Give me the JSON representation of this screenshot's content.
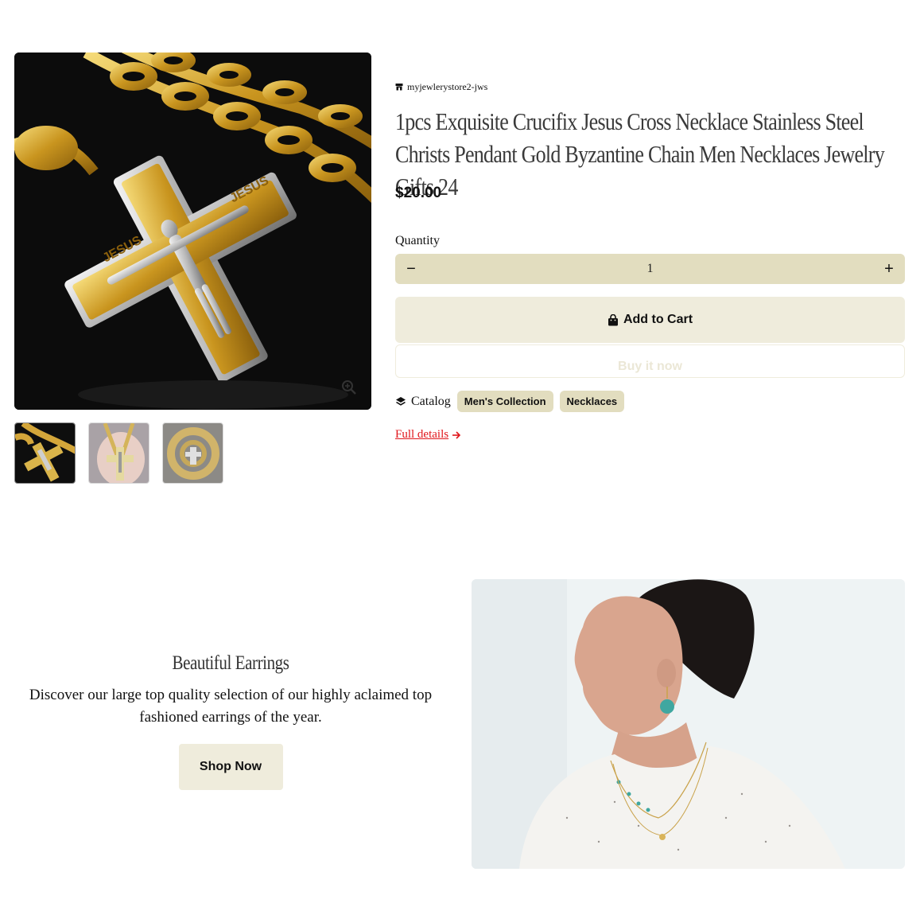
{
  "product": {
    "vendor": "myjewlerystore2-jws",
    "title": "1pcs Exquisite Crucifix Jesus Cross Necklace Stainless Steel Christs Pendant Gold Byzantine Chain Men Necklaces Jewelry Gifts 24",
    "price": "$20.00",
    "quantity_label": "Quantity",
    "quantity_value": "1",
    "decrease_symbol": "−",
    "increase_symbol": "+",
    "add_to_cart_label": "Add to Cart",
    "buy_now_label": "Buy it now",
    "catalog_label": "Catalog",
    "tags": [
      "Men's Collection",
      "Necklaces"
    ],
    "full_details_label": "Full details",
    "cross_engraving": "JESUS"
  },
  "banner": {
    "heading": "Beautiful Earrings",
    "description": "Discover our large top quality selection of our highly aclaimed top fashioned earrings of the year.",
    "button_label": "Shop Now"
  },
  "icons": {
    "vendor": "store-icon",
    "zoom": "zoom-in-icon",
    "cart": "shopping-bag-icon",
    "catalog": "layers-icon",
    "arrow": "arrow-right-icon"
  },
  "colors": {
    "accent_tan": "#e2ddbf",
    "button_cream": "#efecdc",
    "link_red": "#e0151a",
    "text_dark": "#111111"
  }
}
